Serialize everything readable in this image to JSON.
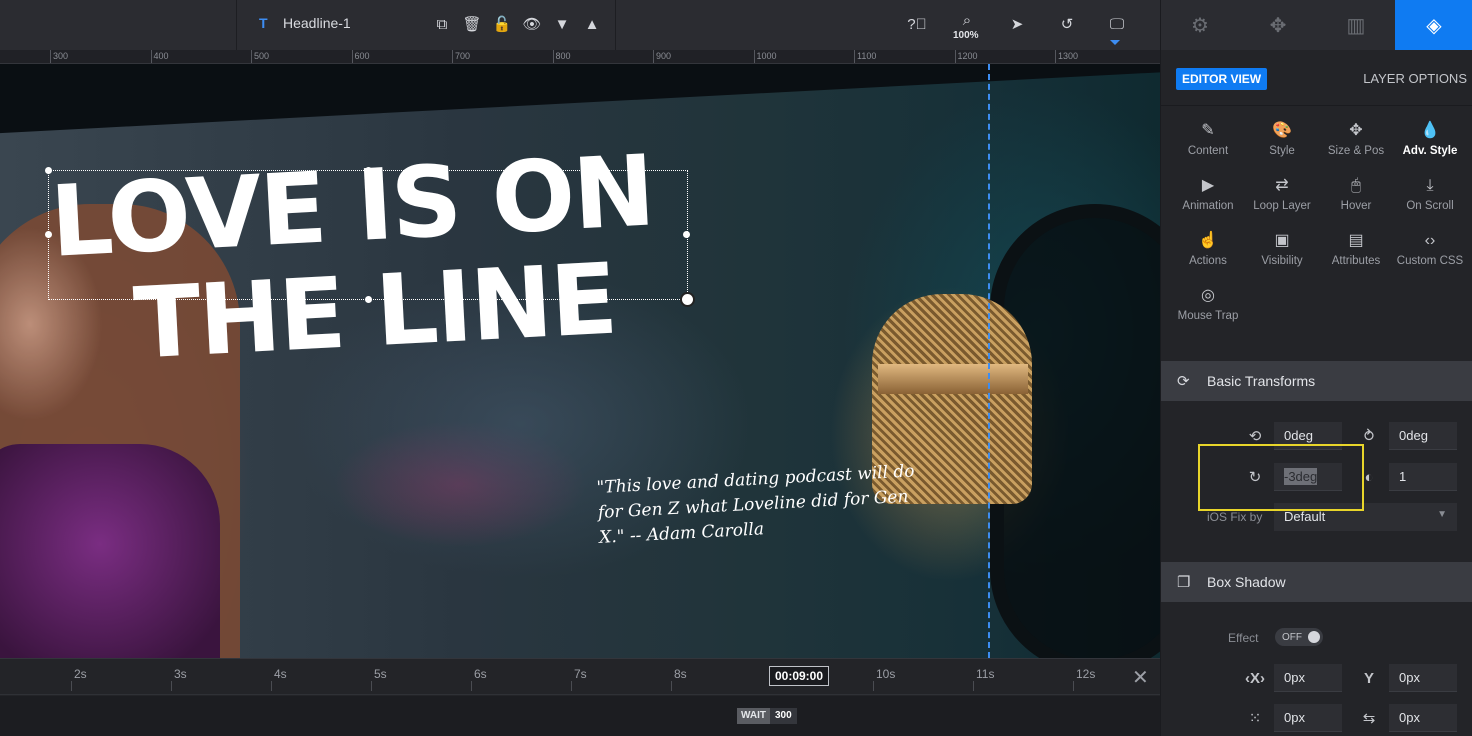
{
  "toolbar": {
    "layer_type_icon": "T",
    "layer_name": "Headline-1",
    "zoom_label": "100%",
    "icons": [
      "duplicate-icon",
      "delete-icon",
      "lock-icon",
      "visibility-eye-icon",
      "move-down-icon",
      "move-up-icon",
      "help-icon",
      "zoom-icon",
      "cursor-icon",
      "undo-icon",
      "desktop-icon"
    ]
  },
  "ruler": {
    "labels": [
      "300",
      "400",
      "500",
      "600",
      "700",
      "800",
      "900",
      "1000",
      "1100",
      "1200",
      "1300"
    ]
  },
  "canvas": {
    "headline_line1": "LOVE IS ON",
    "headline_line2": "THE LINE",
    "quote": "\"This love and dating podcast will do for Gen Z what Loveline did for Gen X.\" -- Adam Carolla"
  },
  "timeline": {
    "labels": [
      "2s",
      "3s",
      "4s",
      "5s",
      "6s",
      "7s",
      "8s",
      "10s",
      "11s",
      "12s"
    ],
    "current_time": "00:09:00",
    "wait_label": "WAIT",
    "wait_value": "300",
    "close_icon": "close-icon"
  },
  "panel": {
    "tabs": [
      "settings-gear-icon",
      "navigation-icon",
      "slides-layout-icon",
      "layers-icon"
    ],
    "active_tab": "layers-icon",
    "editor_view_label": "EDITOR VIEW",
    "layer_options_label": "LAYER OPTIONS",
    "style_items": [
      {
        "label": "Content",
        "icon": "pencil-icon"
      },
      {
        "label": "Style",
        "icon": "palette-icon"
      },
      {
        "label": "Size & Pos",
        "icon": "move-arrows-icon"
      },
      {
        "label": "Adv. Style",
        "icon": "drop-icon"
      },
      {
        "label": "Animation",
        "icon": "play-icon"
      },
      {
        "label": "Loop Layer",
        "icon": "loop-icon"
      },
      {
        "label": "Hover",
        "icon": "mouse-icon"
      },
      {
        "label": "On Scroll",
        "icon": "scroll-download-icon"
      },
      {
        "label": "Actions",
        "icon": "pointer-hand-icon"
      },
      {
        "label": "Visibility",
        "icon": "visibility-image-icon"
      },
      {
        "label": "Attributes",
        "icon": "document-icon"
      },
      {
        "label": "Custom CSS",
        "icon": "code-icon"
      },
      {
        "label": "Mouse Trap",
        "icon": "target-icon"
      }
    ],
    "active_style": "Adv. Style",
    "basic_transforms": {
      "title": "Basic Transforms",
      "rotation_x": "0deg",
      "rotation_y": "0deg",
      "rotation_z": "-3deg",
      "opacity": "1",
      "ios_fix_label": "iOS Fix by",
      "ios_fix_value": "Default"
    },
    "box_shadow": {
      "title": "Box Shadow",
      "effect_label": "Effect",
      "effect_value": "OFF",
      "x_value": "0px",
      "y_value": "0px",
      "blur_value": "0px",
      "spread_value": "0px"
    }
  }
}
